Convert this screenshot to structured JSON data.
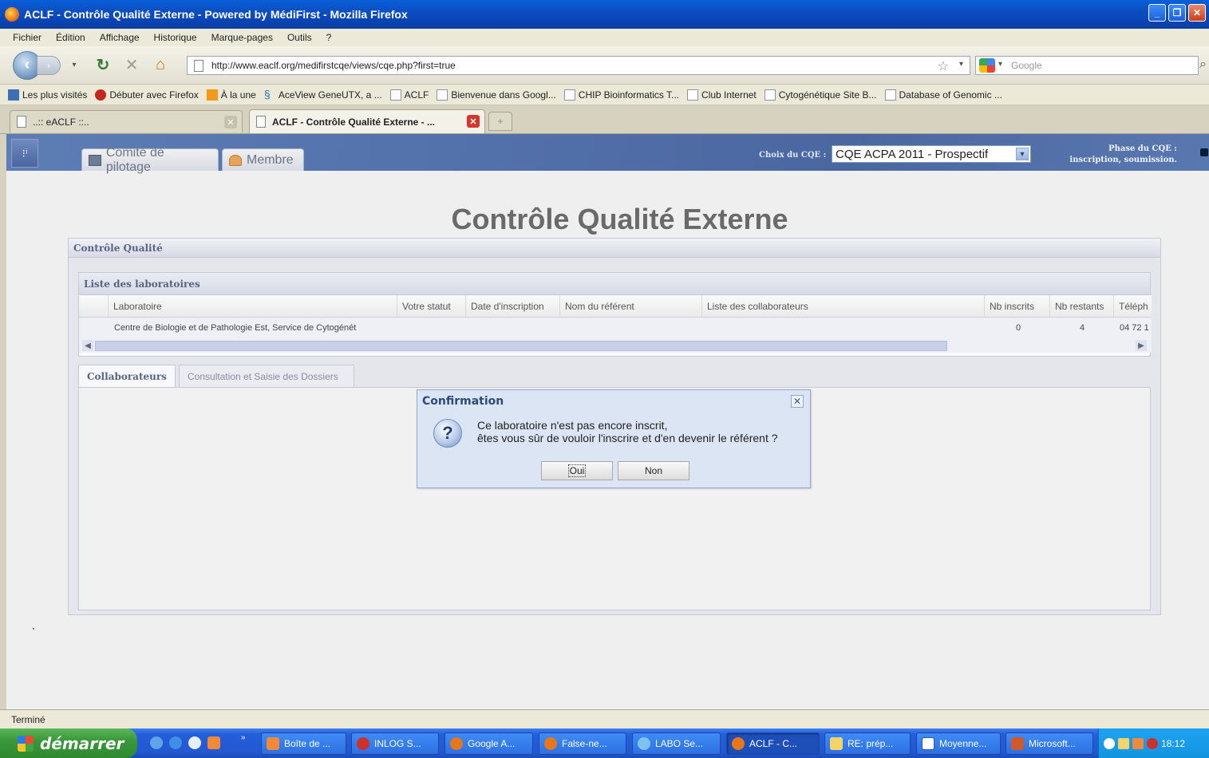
{
  "window": {
    "title": "ACLF - Contrôle Qualité Externe - Powered by MédiFirst - Mozilla Firefox"
  },
  "menu": [
    "Fichier",
    "Édition",
    "Affichage",
    "Historique",
    "Marque-pages",
    "Outils",
    "?"
  ],
  "nav": {
    "url": "http://www.eaclf.org/medifirstcqe/views/cqe.php?first=true",
    "search_placeholder": "Google"
  },
  "bookmarks": [
    "Les plus visités",
    "Débuter avec Firefox",
    "À la une",
    "AceView GeneUTX, a ...",
    "ACLF",
    "Bienvenue dans Googl...",
    "CHIP Bioinformatics T...",
    "Club Internet",
    "Cytogénétique Site B...",
    "Database of Genomic ..."
  ],
  "tabs": [
    {
      "label": "..:: eACLF ::.."
    },
    {
      "label": "ACLF - Contrôle Qualité Externe - ..."
    }
  ],
  "app": {
    "tabs": [
      "Comité de pilotage",
      "Membre"
    ],
    "cqe_label": "Choix du CQE :",
    "cqe_value": "CQE ACPA 2011 - Prospectif",
    "phase_line1": "Phase du CQE :",
    "phase_line2": "inscription, soumission."
  },
  "page_title": "Contrôle Qualité Externe",
  "qc_panel": {
    "title": "Contrôle Qualité",
    "lab_title": "Liste des laboratoires",
    "columns": [
      "Laboratoire",
      "Votre statut",
      "Date d'inscription",
      "Nom du référent",
      "Liste des collaborateurs",
      "Nb inscrits",
      "Nb restants",
      "Téléph"
    ],
    "row": {
      "laboratoire": "Centre de Biologie et de Pathologie Est, Service de Cytogénét",
      "nb_inscrits": "0",
      "nb_restants": "4",
      "telephone": "04 72 1"
    },
    "subtabs": [
      "Collaborateurs",
      "Consultation et Saisie des Dossiers"
    ]
  },
  "dialog": {
    "title": "Confirmation",
    "line1": "Ce laboratoire n'est pas encore inscrit,",
    "line2": "êtes vous sûr de vouloir l'inscrire et d'en devenir le référent ?",
    "ok_label": "Oui",
    "cancel_label": "Non"
  },
  "status": "Terminé",
  "taskbar": {
    "start_label": "démarrer",
    "items": [
      "Boîte de ...",
      "INLOG S...",
      "Google A...",
      "False-ne...",
      "LABO Se...",
      "ACLF - C...",
      "RE: prép...",
      "Moyenne...",
      "Microsoft..."
    ],
    "clock": "18:12"
  },
  "colors": {
    "app_header": "#5270aa",
    "dialog_bg": "#dbe5f3",
    "taskbar": "#245edb",
    "start_button": "#3a973a"
  }
}
